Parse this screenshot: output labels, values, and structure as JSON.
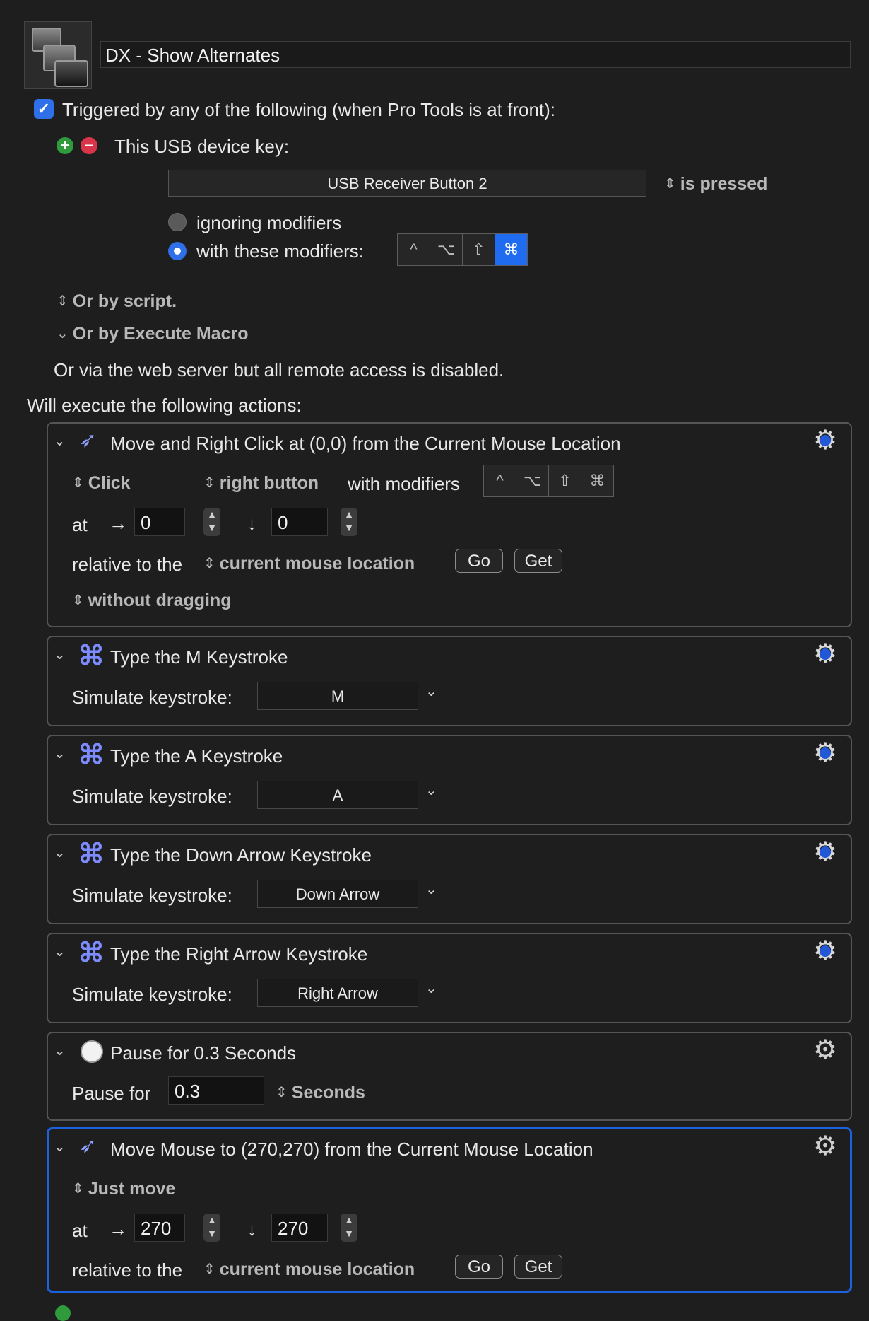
{
  "macro": {
    "name": "DX - Show Alternates",
    "icon": "macro-windows-icon"
  },
  "trigger": {
    "header": "Triggered by any of the following (when Pro Tools is at front):",
    "usb_label": "This USB device key:",
    "usb_key": "USB Receiver Button 2",
    "state": "is pressed",
    "ignoring_label": "ignoring modifiers",
    "with_label": "with these modifiers:",
    "modifiers": [
      "^",
      "⌥",
      "⇧",
      "⌘"
    ],
    "by_script": "Or by script.",
    "by_execute": "Or by Execute Macro",
    "web_server": "Or via the web server but all remote access is disabled."
  },
  "actions_header": "Will execute the following actions:",
  "action1": {
    "title": "Move and Right Click at (0,0) from the Current Mouse Location",
    "click": "Click",
    "button": "right button",
    "with_modifiers": "with modifiers",
    "modifiers": [
      "^",
      "⌥",
      "⇧",
      "⌘"
    ],
    "at": "at",
    "x": "0",
    "y": "0",
    "relative": "relative to the",
    "location": "current mouse location",
    "go": "Go",
    "get": "Get",
    "dragging": "without dragging"
  },
  "action2": {
    "title": "Type the M Keystroke",
    "label": "Simulate keystroke:",
    "key": "M"
  },
  "action3": {
    "title": "Type the A Keystroke",
    "label": "Simulate keystroke:",
    "key": "A"
  },
  "action4": {
    "title": "Type the Down Arrow Keystroke",
    "label": "Simulate keystroke:",
    "key": "Down Arrow"
  },
  "action5": {
    "title": "Type the Right Arrow Keystroke",
    "label": "Simulate keystroke:",
    "key": "Right Arrow"
  },
  "action6": {
    "title": "Pause for 0.3 Seconds",
    "label": "Pause for",
    "value": "0.3",
    "unit": "Seconds"
  },
  "action7": {
    "title": "Move Mouse to (270,270) from the Current Mouse Location",
    "mode": "Just move",
    "at": "at",
    "x": "270",
    "y": "270",
    "relative": "relative to the",
    "location": "current mouse location",
    "go": "Go",
    "get": "Get"
  },
  "glyphs": {
    "chevron_down": "⌄",
    "up_down": "⌃⌄",
    "right_arrow": "→",
    "down_arrow": "↓",
    "gear": "⚙",
    "check": "✓",
    "plus": "+",
    "minus": "−",
    "cmd": "⌘"
  }
}
